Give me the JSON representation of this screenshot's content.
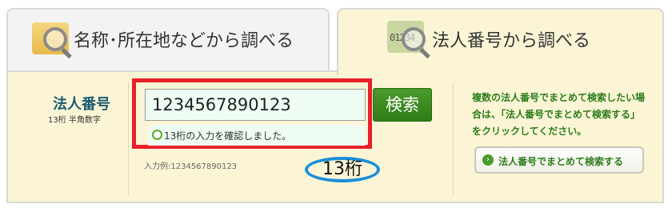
{
  "tabs": [
    {
      "label": "名称･所在地などから調べる",
      "icon": "map-search-icon"
    },
    {
      "label": "法人番号から調べる",
      "icon": "number-search-icon",
      "icon_text": "01234"
    }
  ],
  "form": {
    "label": "法人番号",
    "sublabel": "13桁 半角数字",
    "input_value": "1234567890123",
    "confirm_text": "13桁の入力を確認しました。",
    "search_label": "検索",
    "example": "入力例:1234567890123",
    "annotation": "13桁"
  },
  "side": {
    "text": "複数の法人番号でまとめて検索したい場合は、「法人番号でまとめて検索する」をクリックしてください。",
    "button_label": "法人番号でまとめて検索する",
    "button_icon": "›"
  },
  "colors": {
    "panel_bg": "#fbf5d6",
    "accent_green": "#2f7d18",
    "highlight_red": "#e8202a",
    "annotation_blue": "#1b8fd8"
  }
}
